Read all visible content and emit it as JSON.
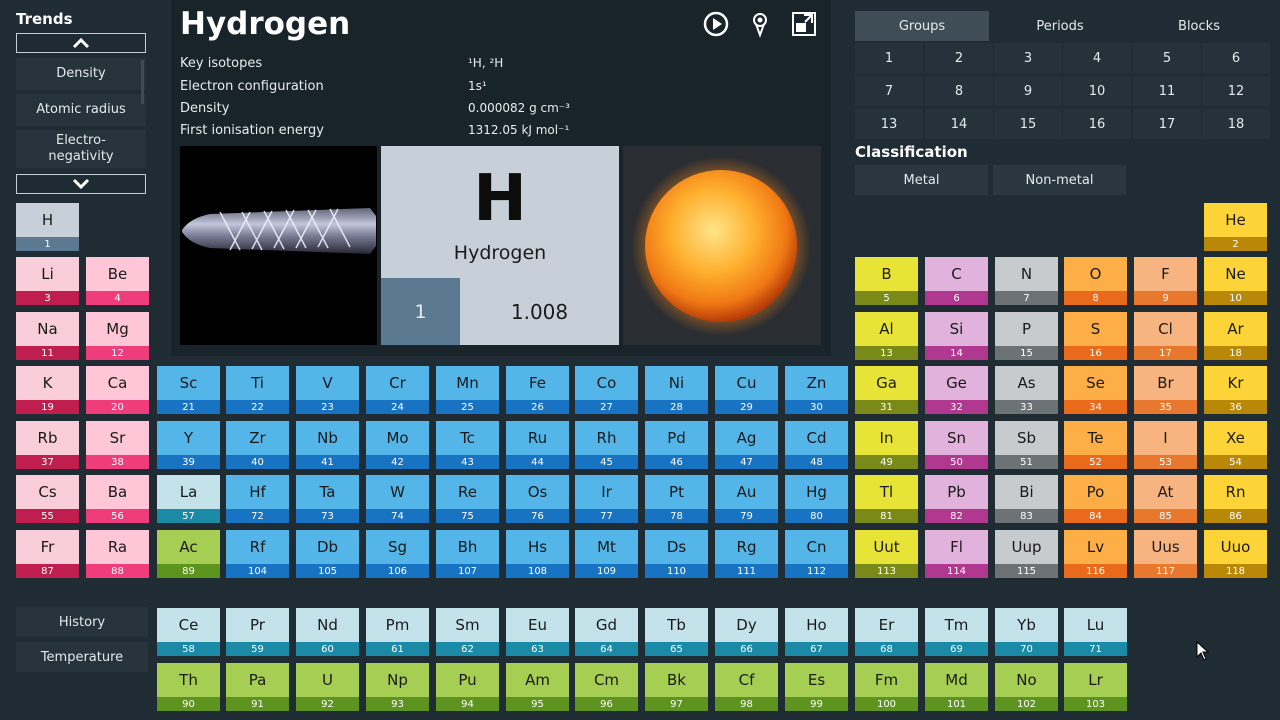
{
  "trends": {
    "title": "Trends",
    "items": [
      "Density",
      "Atomic radius",
      "Electro-\nnegativity"
    ]
  },
  "bottom_menu": [
    "History",
    "Temperature"
  ],
  "element": {
    "name": "Hydrogen",
    "symbol": "H",
    "number": "1",
    "mass": "1.008",
    "props": [
      {
        "label": "Key isotopes",
        "value": "¹H, ²H"
      },
      {
        "label": "Electron configuration",
        "value": "1s¹"
      },
      {
        "label": "Density",
        "value": "0.000082 g cm⁻³"
      },
      {
        "label": "First ionisation energy",
        "value": "1312.05 kJ mol⁻¹"
      }
    ]
  },
  "group_tabs": {
    "tabs": [
      "Groups",
      "Periods",
      "Blocks"
    ],
    "active": "Groups"
  },
  "groups": [
    "1",
    "2",
    "3",
    "4",
    "5",
    "6",
    "7",
    "8",
    "9",
    "10",
    "11",
    "12",
    "13",
    "14",
    "15",
    "16",
    "17",
    "18"
  ],
  "classification": {
    "title": "Classification",
    "buttons": [
      "Metal",
      "Non-metal"
    ]
  },
  "colors": {
    "background": "#202c34",
    "alkali": "#f9cdda",
    "alkaline": "#ffc6d8",
    "transition": "#54b5e8",
    "post_transition": "#e8e437",
    "metalloid": "#e0b2dc",
    "nonmetal": "#c8cbce",
    "halogen": "#f7b481",
    "noble": "#fcd438",
    "lanthanide": "#c4e2ea",
    "actinide": "#a5ce52"
  },
  "elements": [
    {
      "s": "H",
      "n": "1",
      "c": "hydrogen"
    },
    {
      "s": "He",
      "n": "2",
      "c": "noble"
    },
    {
      "s": "Li",
      "n": "3",
      "c": "alkali"
    },
    {
      "s": "Be",
      "n": "4",
      "c": "alkaline"
    },
    {
      "s": "B",
      "n": "5",
      "c": "post"
    },
    {
      "s": "C",
      "n": "6",
      "c": "metalloid"
    },
    {
      "s": "N",
      "n": "7",
      "c": "nonmetal"
    },
    {
      "s": "O",
      "n": "8",
      "c": "oxygen"
    },
    {
      "s": "F",
      "n": "9",
      "c": "halogen"
    },
    {
      "s": "Ne",
      "n": "10",
      "c": "noble"
    },
    {
      "s": "Na",
      "n": "11",
      "c": "alkali"
    },
    {
      "s": "Mg",
      "n": "12",
      "c": "alkaline"
    },
    {
      "s": "Al",
      "n": "13",
      "c": "post"
    },
    {
      "s": "Si",
      "n": "14",
      "c": "metalloid"
    },
    {
      "s": "P",
      "n": "15",
      "c": "nonmetal"
    },
    {
      "s": "S",
      "n": "16",
      "c": "oxygen"
    },
    {
      "s": "Cl",
      "n": "17",
      "c": "halogen"
    },
    {
      "s": "Ar",
      "n": "18",
      "c": "noble"
    },
    {
      "s": "K",
      "n": "19",
      "c": "alkali"
    },
    {
      "s": "Ca",
      "n": "20",
      "c": "alkaline"
    },
    {
      "s": "Sc",
      "n": "21",
      "c": "transition"
    },
    {
      "s": "Ti",
      "n": "22",
      "c": "transition"
    },
    {
      "s": "V",
      "n": "23",
      "c": "transition"
    },
    {
      "s": "Cr",
      "n": "24",
      "c": "transition"
    },
    {
      "s": "Mn",
      "n": "25",
      "c": "transition"
    },
    {
      "s": "Fe",
      "n": "26",
      "c": "transition"
    },
    {
      "s": "Co",
      "n": "27",
      "c": "transition"
    },
    {
      "s": "Ni",
      "n": "28",
      "c": "transition"
    },
    {
      "s": "Cu",
      "n": "29",
      "c": "transition"
    },
    {
      "s": "Zn",
      "n": "30",
      "c": "transition"
    },
    {
      "s": "Ga",
      "n": "31",
      "c": "post"
    },
    {
      "s": "Ge",
      "n": "32",
      "c": "metalloid"
    },
    {
      "s": "As",
      "n": "33",
      "c": "nonmetal"
    },
    {
      "s": "Se",
      "n": "34",
      "c": "oxygen"
    },
    {
      "s": "Br",
      "n": "35",
      "c": "halogen"
    },
    {
      "s": "Kr",
      "n": "36",
      "c": "noble"
    },
    {
      "s": "Rb",
      "n": "37",
      "c": "alkali"
    },
    {
      "s": "Sr",
      "n": "38",
      "c": "alkaline"
    },
    {
      "s": "Y",
      "n": "39",
      "c": "transition"
    },
    {
      "s": "Zr",
      "n": "40",
      "c": "transition"
    },
    {
      "s": "Nb",
      "n": "41",
      "c": "transition"
    },
    {
      "s": "Mo",
      "n": "42",
      "c": "transition"
    },
    {
      "s": "Tc",
      "n": "43",
      "c": "transition"
    },
    {
      "s": "Ru",
      "n": "44",
      "c": "transition"
    },
    {
      "s": "Rh",
      "n": "45",
      "c": "transition"
    },
    {
      "s": "Pd",
      "n": "46",
      "c": "transition"
    },
    {
      "s": "Ag",
      "n": "47",
      "c": "transition"
    },
    {
      "s": "Cd",
      "n": "48",
      "c": "transition"
    },
    {
      "s": "In",
      "n": "49",
      "c": "post"
    },
    {
      "s": "Sn",
      "n": "50",
      "c": "metalloid"
    },
    {
      "s": "Sb",
      "n": "51",
      "c": "nonmetal"
    },
    {
      "s": "Te",
      "n": "52",
      "c": "oxygen"
    },
    {
      "s": "I",
      "n": "53",
      "c": "halogen"
    },
    {
      "s": "Xe",
      "n": "54",
      "c": "noble"
    },
    {
      "s": "Cs",
      "n": "55",
      "c": "alkali"
    },
    {
      "s": "Ba",
      "n": "56",
      "c": "alkaline"
    },
    {
      "s": "La",
      "n": "57",
      "c": "lanthanide"
    },
    {
      "s": "Hf",
      "n": "72",
      "c": "transition"
    },
    {
      "s": "Ta",
      "n": "73",
      "c": "transition"
    },
    {
      "s": "W",
      "n": "74",
      "c": "transition"
    },
    {
      "s": "Re",
      "n": "75",
      "c": "transition"
    },
    {
      "s": "Os",
      "n": "76",
      "c": "transition"
    },
    {
      "s": "Ir",
      "n": "77",
      "c": "transition"
    },
    {
      "s": "Pt",
      "n": "78",
      "c": "transition"
    },
    {
      "s": "Au",
      "n": "79",
      "c": "transition"
    },
    {
      "s": "Hg",
      "n": "80",
      "c": "transition"
    },
    {
      "s": "Tl",
      "n": "81",
      "c": "post"
    },
    {
      "s": "Pb",
      "n": "82",
      "c": "metalloid"
    },
    {
      "s": "Bi",
      "n": "83",
      "c": "nonmetal"
    },
    {
      "s": "Po",
      "n": "84",
      "c": "oxygen"
    },
    {
      "s": "At",
      "n": "85",
      "c": "halogen"
    },
    {
      "s": "Rn",
      "n": "86",
      "c": "noble"
    },
    {
      "s": "Fr",
      "n": "87",
      "c": "alkali"
    },
    {
      "s": "Ra",
      "n": "88",
      "c": "alkaline"
    },
    {
      "s": "Ac",
      "n": "89",
      "c": "actinide"
    },
    {
      "s": "Rf",
      "n": "104",
      "c": "transition"
    },
    {
      "s": "Db",
      "n": "105",
      "c": "transition"
    },
    {
      "s": "Sg",
      "n": "106",
      "c": "transition"
    },
    {
      "s": "Bh",
      "n": "107",
      "c": "transition"
    },
    {
      "s": "Hs",
      "n": "108",
      "c": "transition"
    },
    {
      "s": "Mt",
      "n": "109",
      "c": "transition"
    },
    {
      "s": "Ds",
      "n": "110",
      "c": "transition"
    },
    {
      "s": "Rg",
      "n": "111",
      "c": "transition"
    },
    {
      "s": "Cn",
      "n": "112",
      "c": "transition"
    },
    {
      "s": "Uut",
      "n": "113",
      "c": "post"
    },
    {
      "s": "Fl",
      "n": "114",
      "c": "metalloid"
    },
    {
      "s": "Uup",
      "n": "115",
      "c": "nonmetal"
    },
    {
      "s": "Lv",
      "n": "116",
      "c": "oxygen"
    },
    {
      "s": "Uus",
      "n": "117",
      "c": "halogen"
    },
    {
      "s": "Uuo",
      "n": "118",
      "c": "noble"
    },
    {
      "s": "Ce",
      "n": "58",
      "c": "lanthanide"
    },
    {
      "s": "Pr",
      "n": "59",
      "c": "lanthanide"
    },
    {
      "s": "Nd",
      "n": "60",
      "c": "lanthanide"
    },
    {
      "s": "Pm",
      "n": "61",
      "c": "lanthanide"
    },
    {
      "s": "Sm",
      "n": "62",
      "c": "lanthanide"
    },
    {
      "s": "Eu",
      "n": "63",
      "c": "lanthanide"
    },
    {
      "s": "Gd",
      "n": "64",
      "c": "lanthanide"
    },
    {
      "s": "Tb",
      "n": "65",
      "c": "lanthanide"
    },
    {
      "s": "Dy",
      "n": "66",
      "c": "lanthanide"
    },
    {
      "s": "Ho",
      "n": "67",
      "c": "lanthanide"
    },
    {
      "s": "Er",
      "n": "68",
      "c": "lanthanide"
    },
    {
      "s": "Tm",
      "n": "69",
      "c": "lanthanide"
    },
    {
      "s": "Yb",
      "n": "70",
      "c": "lanthanide"
    },
    {
      "s": "Lu",
      "n": "71",
      "c": "lanthanide"
    },
    {
      "s": "Th",
      "n": "90",
      "c": "actinide"
    },
    {
      "s": "Pa",
      "n": "91",
      "c": "actinide"
    },
    {
      "s": "U",
      "n": "92",
      "c": "actinide"
    },
    {
      "s": "Np",
      "n": "93",
      "c": "actinide"
    },
    {
      "s": "Pu",
      "n": "94",
      "c": "actinide"
    },
    {
      "s": "Am",
      "n": "95",
      "c": "actinide"
    },
    {
      "s": "Cm",
      "n": "96",
      "c": "actinide"
    },
    {
      "s": "Bk",
      "n": "97",
      "c": "actinide"
    },
    {
      "s": "Cf",
      "n": "98",
      "c": "actinide"
    },
    {
      "s": "Es",
      "n": "99",
      "c": "actinide"
    },
    {
      "s": "Fm",
      "n": "100",
      "c": "actinide"
    },
    {
      "s": "Md",
      "n": "101",
      "c": "actinide"
    },
    {
      "s": "No",
      "n": "102",
      "c": "actinide"
    },
    {
      "s": "Lr",
      "n": "103",
      "c": "actinide"
    }
  ]
}
